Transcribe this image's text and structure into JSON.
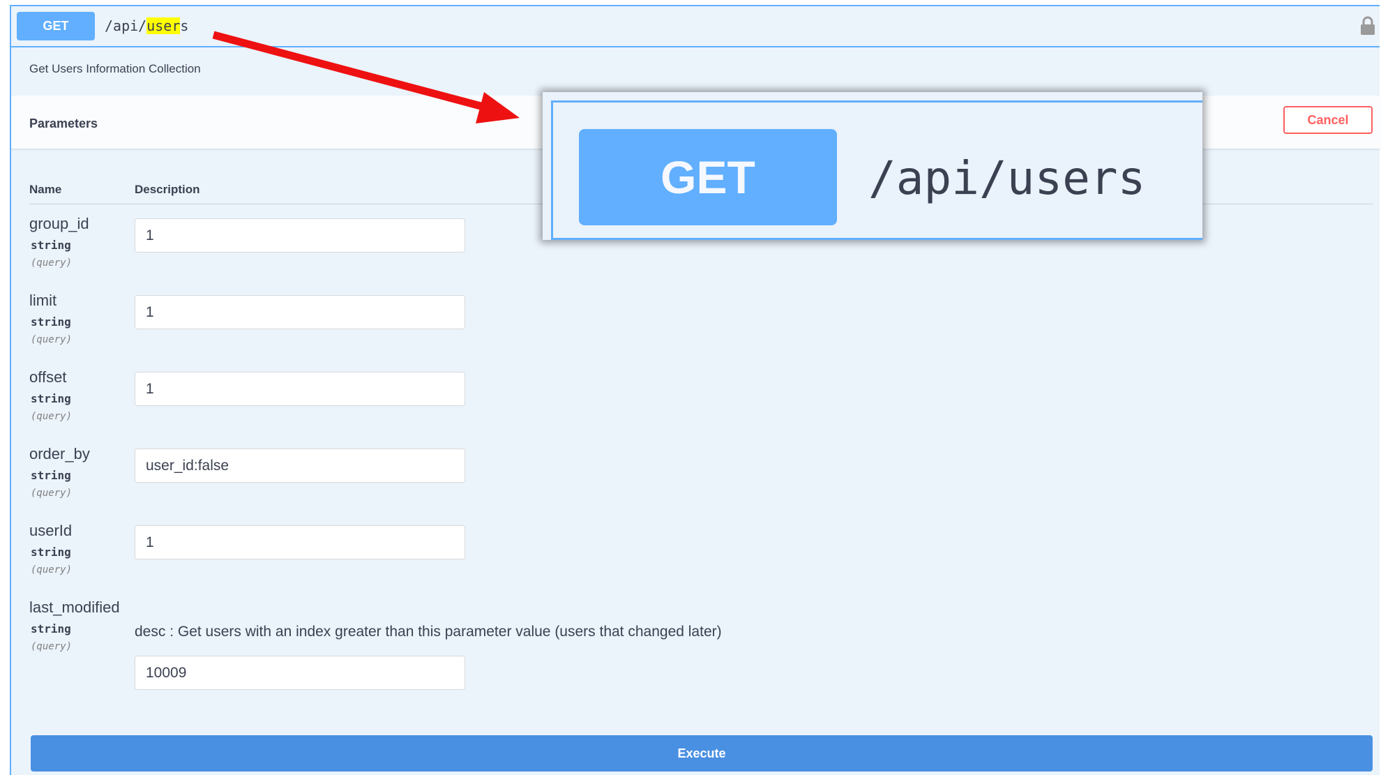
{
  "operation": {
    "method": "GET",
    "path_prefix": "/api/",
    "path_highlight": "user",
    "path_suffix": "s",
    "lock_icon": "lock-icon",
    "description": "Get Users Information Collection"
  },
  "parameters": {
    "title": "Parameters",
    "cancel_label": "Cancel",
    "col_name": "Name",
    "col_description": "Description",
    "items": [
      {
        "name": "group_id",
        "type": "string",
        "in": "(query)",
        "value": "1"
      },
      {
        "name": "limit",
        "type": "string",
        "in": "(query)",
        "value": "1"
      },
      {
        "name": "offset",
        "type": "string",
        "in": "(query)",
        "value": "1"
      },
      {
        "name": "order_by",
        "type": "string",
        "in": "(query)",
        "value": "user_id:false"
      },
      {
        "name": "userId",
        "type": "string",
        "in": "(query)",
        "value": "1"
      },
      {
        "name": "last_modified",
        "type": "string",
        "in": "(query)",
        "value": "10009",
        "description": "desc : Get users with an index greater than this parameter value (users that changed later)"
      }
    ]
  },
  "execute_label": "Execute",
  "zoom_callout": {
    "method": "GET",
    "path": "/api/users"
  },
  "colors": {
    "get_blue": "#61affe",
    "execute_blue": "#4990e2",
    "cancel_red": "#ff6060",
    "arrow_red": "#ee1111",
    "highlight": "#ffff00"
  }
}
